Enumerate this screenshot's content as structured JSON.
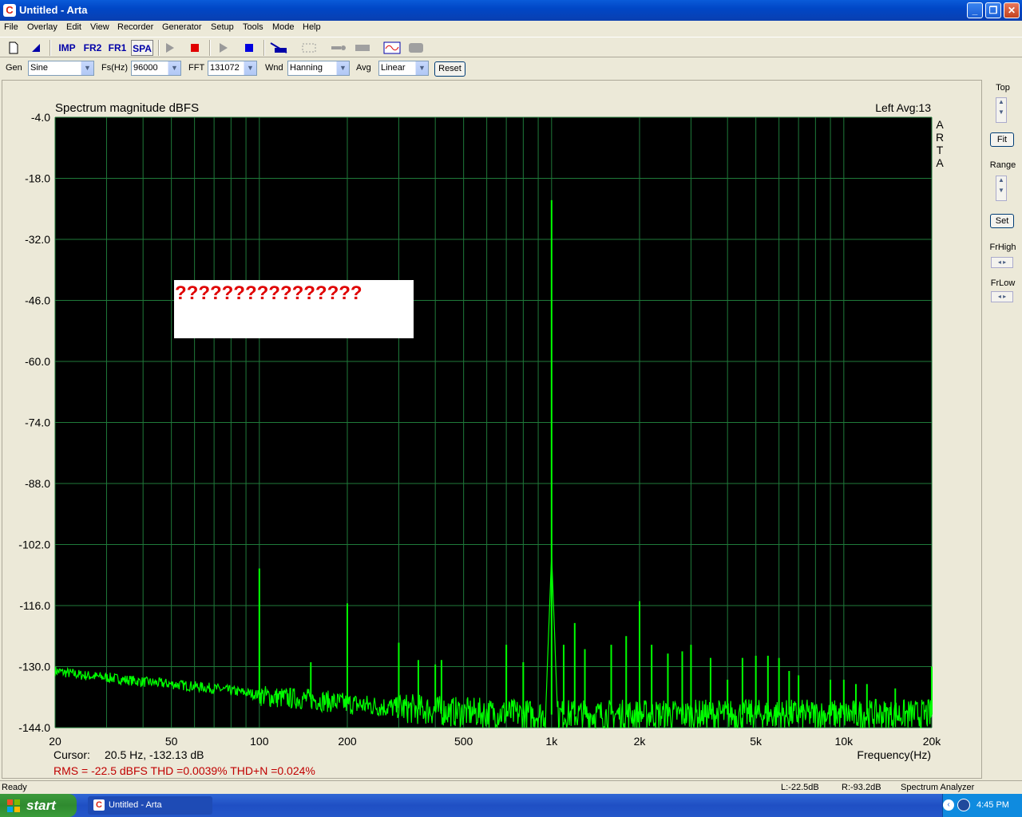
{
  "window": {
    "title": "Untitled - Arta",
    "app_icon": "arta-logo-icon"
  },
  "menu": [
    "File",
    "Overlay",
    "Edit",
    "View",
    "Recorder",
    "Generator",
    "Setup",
    "Tools",
    "Mode",
    "Help"
  ],
  "toolbar": {
    "imp": "IMP",
    "fr2": "FR2",
    "fr1": "FR1",
    "spa": "SPA"
  },
  "controls": {
    "gen_label": "Gen",
    "gen_value": "Sine",
    "fs_label": "Fs(Hz)",
    "fs_value": "96000",
    "fft_label": "FFT",
    "fft_value": "131072",
    "wnd_label": "Wnd",
    "wnd_value": "Hanning",
    "avg_label": "Avg",
    "avg_value": "Linear",
    "reset": "Reset"
  },
  "side": {
    "top": "Top",
    "fit": "Fit",
    "range": "Range",
    "set": "Set",
    "frhigh": "FrHigh",
    "frlow": "FrLow"
  },
  "plot": {
    "title": "Spectrum magnitude dBFS",
    "channel": "Left  Avg:13",
    "brand_letters": [
      "A",
      "R",
      "T",
      "A"
    ],
    "overlay_text": "????????????????",
    "cursor_label": "Cursor:",
    "cursor_value": "20.5 Hz, -132.13 dB",
    "xlabel": "Frequency(Hz)",
    "measurements": "RMS =  -22.5 dBFS   THD =0.0039%   THD+N =0.024%"
  },
  "chart_data": {
    "type": "line",
    "title": "Spectrum magnitude dBFS",
    "xlabel": "Frequency(Hz)",
    "ylabel": "",
    "xscale": "log",
    "xlim": [
      20,
      20000
    ],
    "ylim": [
      -144,
      -4
    ],
    "y_ticks": [
      "-4.0",
      "-18.0",
      "-32.0",
      "-46.0",
      "-60.0",
      "-74.0",
      "-88.0",
      "-102.0",
      "-116.0",
      "-130.0",
      "-144.0"
    ],
    "x_ticks": [
      {
        "value": 20,
        "label": "20"
      },
      {
        "value": 50,
        "label": "50"
      },
      {
        "value": 100,
        "label": "100"
      },
      {
        "value": 200,
        "label": "200"
      },
      {
        "value": 500,
        "label": "500"
      },
      {
        "value": 1000,
        "label": "1k"
      },
      {
        "value": 2000,
        "label": "2k"
      },
      {
        "value": 5000,
        "label": "5k"
      },
      {
        "value": 10000,
        "label": "10k"
      },
      {
        "value": 20000,
        "label": "20k"
      }
    ],
    "grid": true,
    "background": "#000000",
    "grid_color": "#1f7a3a",
    "line_color": "#00ff00",
    "noise_floor": [
      {
        "x": 20,
        "y": -131
      },
      {
        "x": 25,
        "y": -132
      },
      {
        "x": 30,
        "y": -132.5
      },
      {
        "x": 40,
        "y": -133.5
      },
      {
        "x": 50,
        "y": -134
      },
      {
        "x": 70,
        "y": -135
      },
      {
        "x": 90,
        "y": -136
      },
      {
        "x": 110,
        "y": -137
      },
      {
        "x": 150,
        "y": -137.5
      },
      {
        "x": 200,
        "y": -138.5
      },
      {
        "x": 300,
        "y": -139.5
      },
      {
        "x": 500,
        "y": -140.5
      },
      {
        "x": 900,
        "y": -141
      },
      {
        "x": 1200,
        "y": -141
      },
      {
        "x": 2000,
        "y": -141
      },
      {
        "x": 5000,
        "y": -141
      },
      {
        "x": 10000,
        "y": -141
      },
      {
        "x": 20000,
        "y": -141
      }
    ],
    "peaks": [
      {
        "x": 100,
        "y": -107.5
      },
      {
        "x": 150,
        "y": -129
      },
      {
        "x": 200,
        "y": -115.5
      },
      {
        "x": 300,
        "y": -124.5
      },
      {
        "x": 350,
        "y": -128.5
      },
      {
        "x": 400,
        "y": -129.5
      },
      {
        "x": 420,
        "y": -128.5
      },
      {
        "x": 700,
        "y": -125
      },
      {
        "x": 800,
        "y": -129
      },
      {
        "x": 1000,
        "y": -23
      },
      {
        "x": 1100,
        "y": -125
      },
      {
        "x": 1200,
        "y": -120
      },
      {
        "x": 1300,
        "y": -126
      },
      {
        "x": 1600,
        "y": -125
      },
      {
        "x": 1800,
        "y": -123
      },
      {
        "x": 2000,
        "y": -115
      },
      {
        "x": 2200,
        "y": -125
      },
      {
        "x": 2500,
        "y": -127
      },
      {
        "x": 2800,
        "y": -126.5
      },
      {
        "x": 3000,
        "y": -125
      },
      {
        "x": 3500,
        "y": -128
      },
      {
        "x": 4000,
        "y": -133
      },
      {
        "x": 4500,
        "y": -128
      },
      {
        "x": 5000,
        "y": -127.5
      },
      {
        "x": 5500,
        "y": -127.5
      },
      {
        "x": 6000,
        "y": -128
      },
      {
        "x": 6500,
        "y": -131
      },
      {
        "x": 7000,
        "y": -132
      },
      {
        "x": 9000,
        "y": -133
      },
      {
        "x": 10000,
        "y": -133
      },
      {
        "x": 11000,
        "y": -134
      },
      {
        "x": 12000,
        "y": -134
      },
      {
        "x": 15000,
        "y": -135
      },
      {
        "x": 20000,
        "y": -130
      }
    ]
  },
  "status": {
    "left": "Ready",
    "l_level": "L:-22.5dB",
    "r_level": "R:-93.2dB",
    "mode": "Spectrum Analyzer"
  },
  "taskbar": {
    "start": "start",
    "task": "Untitled - Arta",
    "clock": "4:45 PM"
  },
  "colors": {
    "measure_text": "#c00000",
    "overlay_text": "#e00000"
  }
}
